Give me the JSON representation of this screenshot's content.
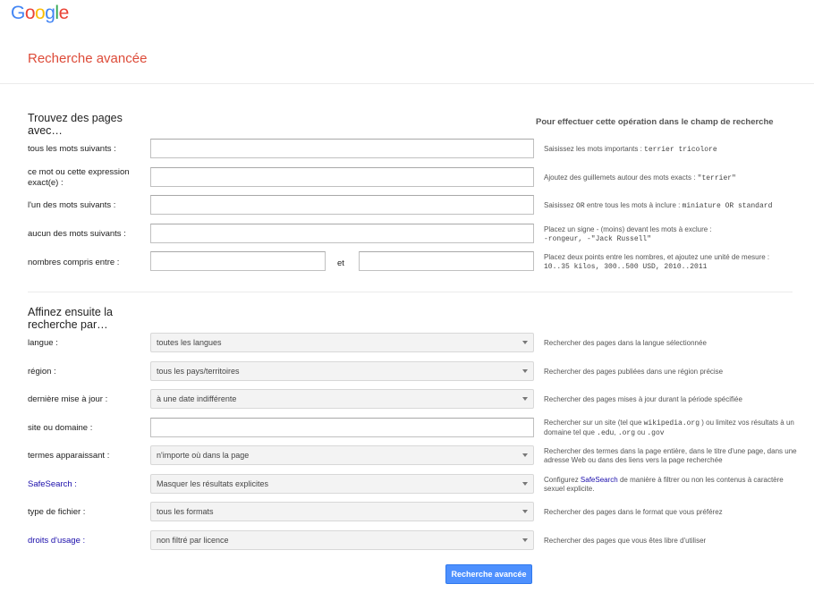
{
  "logo": {
    "letters": [
      "G",
      "o",
      "o",
      "g",
      "l",
      "e"
    ],
    "colors": [
      "#4285f4",
      "#ea4335",
      "#fbbc05",
      "#4285f4",
      "#34a853",
      "#ea4335"
    ]
  },
  "page_title": "Recherche avancée",
  "find": {
    "heading": "Trouvez des pages avec…",
    "hint_heading": "Pour effectuer cette opération dans le champ de recherche",
    "all_words": {
      "label": "tous les mots suivants :",
      "value": "",
      "hint_text": "Saisissez les mots importants : ",
      "hint_code": "terrier tricolore"
    },
    "exact_phrase": {
      "label": "ce mot ou cette expression exact(e) :",
      "value": "",
      "hint_text": "Ajoutez des guillemets autour des mots exacts : ",
      "hint_code": "\"terrier\""
    },
    "any_words": {
      "label": "l'un des mots suivants :",
      "value": "",
      "hint_a": "Saisissez ",
      "hint_or": "OR",
      "hint_b": " entre tous les mots à inclure : ",
      "hint_code": "miniature OR standard"
    },
    "none_words": {
      "label": "aucun des mots suivants :",
      "value": "",
      "hint_text": "Placez un signe - (moins) devant les mots à exclure :",
      "hint_code": "-rongeur, -\"Jack Russell\""
    },
    "numbers_range": {
      "label": "nombres compris entre :",
      "from_value": "",
      "to_value": "",
      "and_label": "et",
      "hint_text": "Placez deux points entre les nombres, et ajoutez une unité de mesure :",
      "hint_code": "10..35 kilos, 300..500 USD, 2010..2011"
    }
  },
  "narrow": {
    "heading": "Affinez ensuite la recherche par…",
    "language": {
      "label": "langue :",
      "selected": "toutes les langues",
      "hint": "Rechercher des pages dans la langue sélectionnée"
    },
    "region": {
      "label": "région :",
      "selected": "tous les pays/territoires",
      "hint": "Rechercher des pages publiées dans une région précise"
    },
    "last_update": {
      "label": "dernière mise à jour :",
      "selected": "à une date indifférente",
      "hint": "Rechercher des pages mises à jour durant la période spécifiée"
    },
    "site": {
      "label": "site ou domaine :",
      "value": "",
      "hint_a": "Rechercher sur un site (tel que ",
      "hint_code1": "wikipedia.org",
      "hint_b": " ) ou limitez vos résultats à un domaine tel que ",
      "hint_code2": ".edu",
      "hint_c": ", ",
      "hint_code3": ".org",
      "hint_d": " ou ",
      "hint_code4": ".gov"
    },
    "terms_appearing": {
      "label": "termes apparaissant :",
      "selected": "n'importe où dans la page",
      "hint": "Rechercher des termes dans la page entière, dans le titre d'une page, dans une adresse Web ou dans des liens vers la page recherchée"
    },
    "safesearch": {
      "label": "SafeSearch :",
      "selected": "Masquer les résultats explicites",
      "hint_a": "Configurez ",
      "hint_link": "SafeSearch",
      "hint_b": " de manière à filtrer ou non les contenus à caractère sexuel explicite."
    },
    "file_type": {
      "label": "type de fichier :",
      "selected": "tous les formats",
      "hint": "Rechercher des pages dans le format que vous préférez"
    },
    "usage_rights": {
      "label": "droits d'usage :",
      "selected": "non filtré par licence",
      "hint": "Rechercher des pages que vous êtes libre d'utiliser"
    }
  },
  "submit_label": "Recherche avancée"
}
